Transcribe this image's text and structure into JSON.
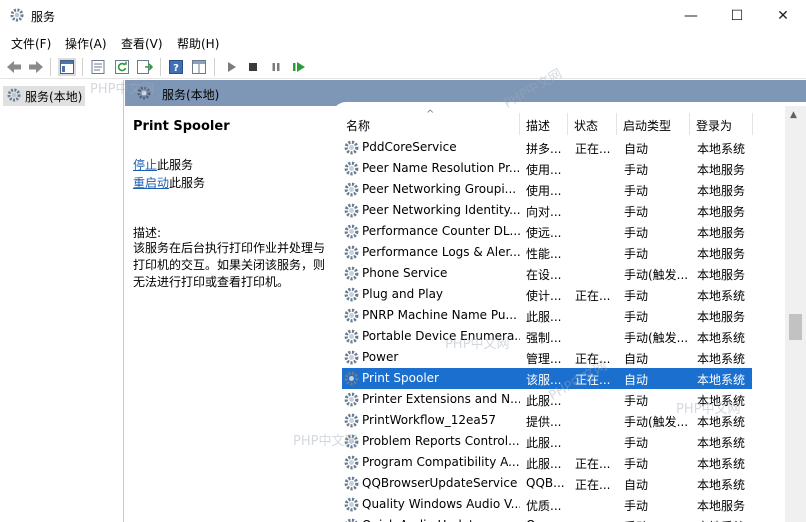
{
  "window": {
    "title": "服务",
    "minimize_glyph": "—",
    "maximize_glyph": "☐",
    "close_glyph": "✕"
  },
  "menu": {
    "items": [
      "文件(F)",
      "操作(A)",
      "查看(V)",
      "帮助(H)"
    ]
  },
  "tree": {
    "root_label": "服务(本地)"
  },
  "header": {
    "title": "服务(本地)"
  },
  "details": {
    "service_name": "Print Spooler",
    "stop_link": "停止",
    "stop_suffix": "此服务",
    "restart_link": "重启动",
    "restart_suffix": "此服务",
    "desc_label": "描述:",
    "desc_text": "该服务在后台执行打印作业并处理与打印机的交互。如果关闭该服务，则无法进行打印或查看打印机。"
  },
  "table": {
    "sort_indicator": "^",
    "columns": {
      "name": "名称",
      "desc": "描述",
      "status": "状态",
      "startup": "启动类型",
      "logon": "登录为"
    },
    "rows": [
      {
        "name": "PddCoreService",
        "desc": "拼多...",
        "status": "正在...",
        "startup": "自动",
        "logon": "本地系统"
      },
      {
        "name": "Peer Name Resolution Pr...",
        "desc": "使用...",
        "status": "",
        "startup": "手动",
        "logon": "本地服务"
      },
      {
        "name": "Peer Networking Groupi...",
        "desc": "使用...",
        "status": "",
        "startup": "手动",
        "logon": "本地服务"
      },
      {
        "name": "Peer Networking Identity...",
        "desc": "向对...",
        "status": "",
        "startup": "手动",
        "logon": "本地服务"
      },
      {
        "name": "Performance Counter DL...",
        "desc": "使远...",
        "status": "",
        "startup": "手动",
        "logon": "本地服务"
      },
      {
        "name": "Performance Logs & Aler...",
        "desc": "性能...",
        "status": "",
        "startup": "手动",
        "logon": "本地服务"
      },
      {
        "name": "Phone Service",
        "desc": "在设...",
        "status": "",
        "startup": "手动(触发...",
        "logon": "本地服务"
      },
      {
        "name": "Plug and Play",
        "desc": "使计...",
        "status": "正在...",
        "startup": "手动",
        "logon": "本地系统"
      },
      {
        "name": "PNRP Machine Name Pu...",
        "desc": "此服...",
        "status": "",
        "startup": "手动",
        "logon": "本地服务"
      },
      {
        "name": "Portable Device Enumera...",
        "desc": "强制...",
        "status": "",
        "startup": "手动(触发...",
        "logon": "本地系统"
      },
      {
        "name": "Power",
        "desc": "管理...",
        "status": "正在...",
        "startup": "自动",
        "logon": "本地系统"
      },
      {
        "name": "Print Spooler",
        "desc": "该服...",
        "status": "正在...",
        "startup": "自动",
        "logon": "本地系统",
        "selected": true
      },
      {
        "name": "Printer Extensions and N...",
        "desc": "此服...",
        "status": "",
        "startup": "手动",
        "logon": "本地系统"
      },
      {
        "name": "PrintWorkflow_12ea57",
        "desc": "提供...",
        "status": "",
        "startup": "手动(触发...",
        "logon": "本地系统"
      },
      {
        "name": "Problem Reports Control...",
        "desc": "此服...",
        "status": "",
        "startup": "手动",
        "logon": "本地系统"
      },
      {
        "name": "Program Compatibility A...",
        "desc": "此服...",
        "status": "正在...",
        "startup": "手动",
        "logon": "本地系统"
      },
      {
        "name": "QQBrowserUpdateService",
        "desc": "QQB...",
        "status": "正在...",
        "startup": "自动",
        "logon": "本地系统"
      },
      {
        "name": "Quality Windows Audio V...",
        "desc": "优质...",
        "status": "",
        "startup": "手动",
        "logon": "本地服务"
      },
      {
        "name": "Quick Audio Update...",
        "desc": "Q...",
        "status": "",
        "startup": "手动",
        "logon": "本地系统"
      }
    ]
  },
  "watermarks": [
    "PHP中文网",
    "PHP中文网",
    "PHP中文网",
    "PHP中文网",
    "PHP中文网",
    "PHP中文网"
  ],
  "colors": {
    "header_band": "#7f97b6",
    "selection": "#1a6fcf",
    "link": "#1a5fb4"
  }
}
